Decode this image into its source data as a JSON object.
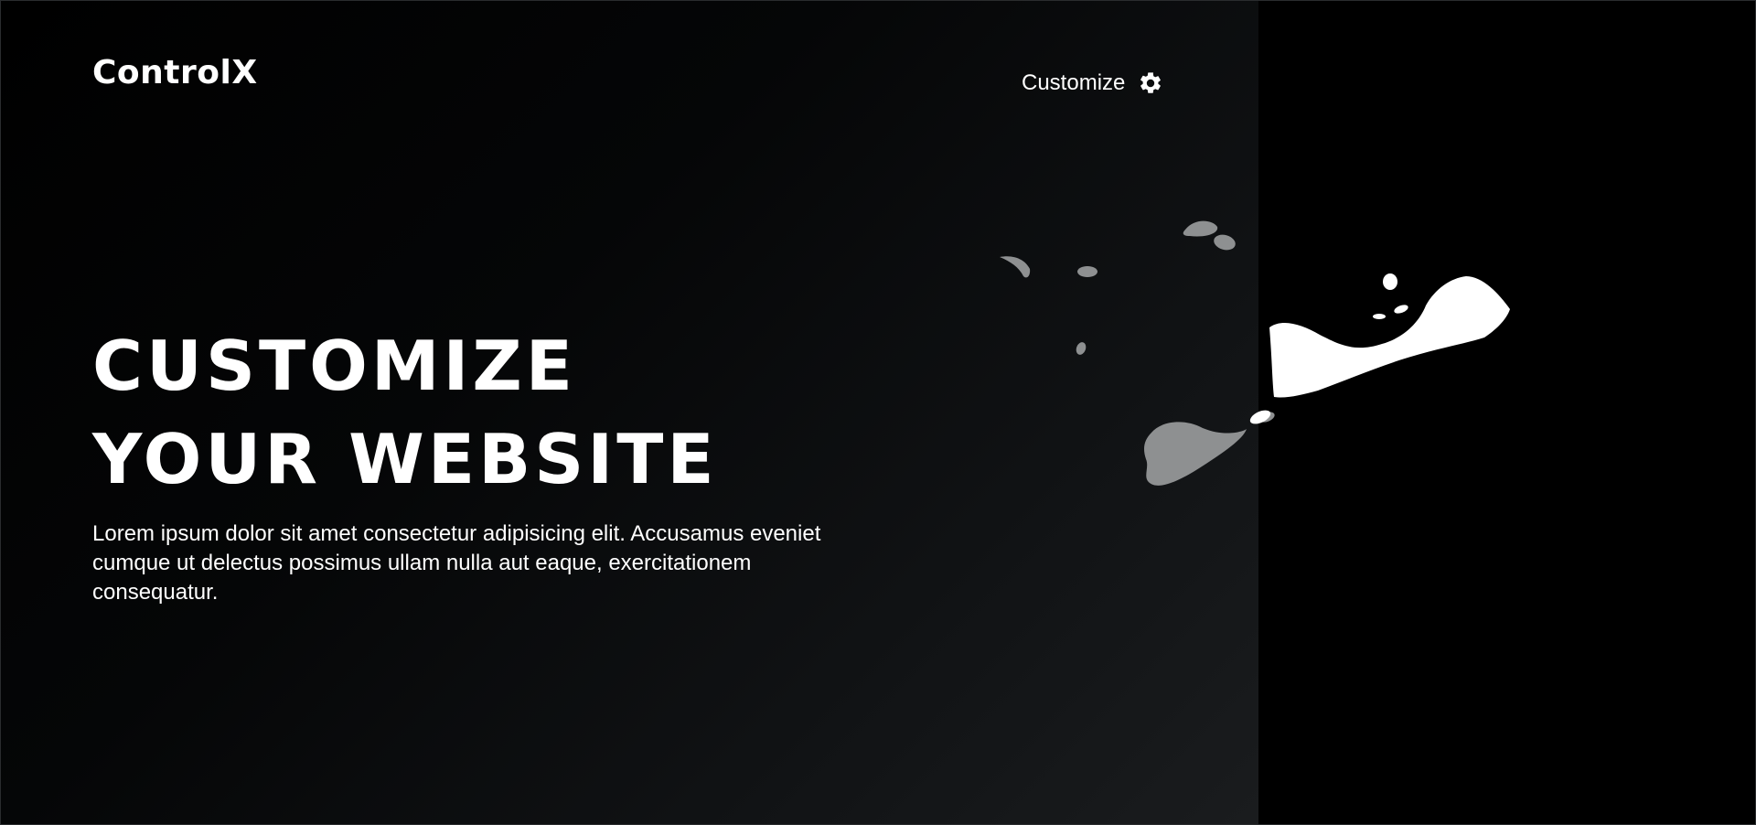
{
  "brand": {
    "logo_text": "ControlX"
  },
  "header": {
    "customize_label": "Customize",
    "customize_icon": "gear-icon"
  },
  "hero": {
    "headline_line1": "CUSTOMIZE",
    "headline_line2": "YOUR WEBSITE",
    "description": "Lorem ipsum dolor sit amet consectetur adipisicing elit. Accusamus eveniet cumque ut delectus possimus ullam nulla aut eaque, exercitationem consequatur."
  },
  "decoration": {
    "splash_icon": "paint-splash-icon"
  },
  "colors": {
    "background": "#000000",
    "text": "#ffffff",
    "splash_gray": "#8e9091",
    "splash_white": "#ffffff"
  }
}
